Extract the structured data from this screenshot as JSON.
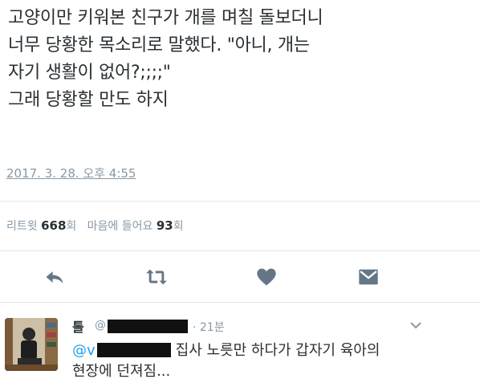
{
  "tweet": {
    "lines": [
      "고양이만 키워본 친구가 개를 며칠 돌보더니",
      "너무 당황한 목소리로 말했다. \"아니, 개는",
      "자기 생활이 없어?;;;;\"",
      "그래 당황할 만도 하지"
    ],
    "timestamp": "2017. 3. 28. 오후 4:55"
  },
  "stats": {
    "retweets_label": "리트윗",
    "retweets_count": "668",
    "retweets_unit": "회",
    "likes_label": "마음에 들어요",
    "likes_count": "93",
    "likes_unit": "회"
  },
  "actions": [
    {
      "name": "reply",
      "icon": "reply-icon"
    },
    {
      "name": "retweet",
      "icon": "retweet-icon"
    },
    {
      "name": "like",
      "icon": "heart-icon"
    },
    {
      "name": "message",
      "icon": "envelope-icon"
    }
  ],
  "reply": {
    "name": "톨",
    "handle_prefix": "@",
    "time": "· 21분",
    "mention_prefix": "@v",
    "text_line1": "집사 노릇만 하다가 갑자기 육아의",
    "text_line2": "현장에 던져짐..."
  },
  "colors": {
    "text": "#292f33",
    "muted": "#8899a6",
    "accent": "#1da1f2",
    "icon": "#657786",
    "divider": "#e1e8ed"
  }
}
